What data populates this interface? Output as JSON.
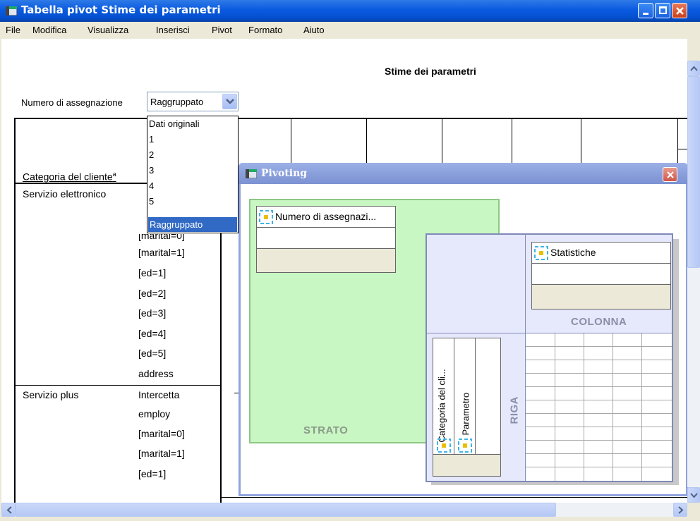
{
  "window": {
    "title": "Tabella pivot Stime dei parametri"
  },
  "menu": [
    "File",
    "Modifica",
    "Visualizza",
    "Inserisci",
    "Pivot",
    "Formato",
    "Aiuto"
  ],
  "table": {
    "title": "Stime dei parametri",
    "layer_label": "Numero di assegnazione",
    "layer_value": "Raggruppato",
    "row_header": "Categoria del cliente",
    "row_header_sup": "a",
    "groups": [
      {
        "name": "Servizio elettronico",
        "params": [
          "[marital=1]",
          "[ed=1]",
          "[ed=2]",
          "[ed=3]",
          "[ed=4]",
          "[ed=5]",
          "address"
        ]
      },
      {
        "name": "Servizio plus",
        "params": [
          "Intercetta",
          "employ",
          "[marital=0]",
          "[marital=1]",
          "[ed=1]"
        ]
      }
    ]
  },
  "dropdown": {
    "options": [
      "Dati originali",
      "1",
      "2",
      "3",
      "4",
      "5",
      "Raggruppato"
    ],
    "selected": "Raggruppato"
  },
  "pivoting": {
    "title": "Pivoting",
    "layer_label": "STRATO",
    "layer_item": "Numero di assegnazi...",
    "column_label": "COLONNA",
    "column_item": "Statistiche",
    "row_label": "RIGA",
    "row_items": [
      "Categoria del cli...",
      "Parametro"
    ]
  }
}
